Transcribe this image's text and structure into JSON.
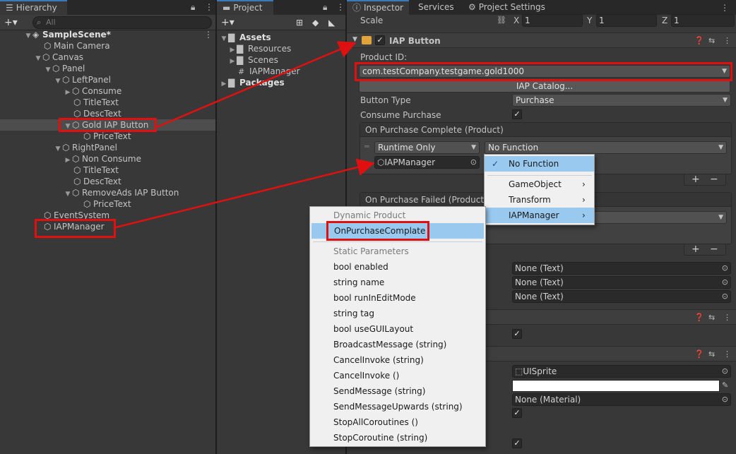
{
  "hierarchy": {
    "tab_label": "Hierarchy",
    "add_label": "+▾",
    "search_placeholder": "All",
    "items": [
      {
        "label": "SampleScene*"
      },
      {
        "label": "Main Camera"
      },
      {
        "label": "Canvas"
      },
      {
        "label": "Panel"
      },
      {
        "label": "LeftPanel"
      },
      {
        "label": "Consume"
      },
      {
        "label": "TitleText"
      },
      {
        "label": "DescText"
      },
      {
        "label": "Gold IAP Button"
      },
      {
        "label": "PriceText"
      },
      {
        "label": "RightPanel"
      },
      {
        "label": "Non Consume"
      },
      {
        "label": "TitleText"
      },
      {
        "label": "DescText"
      },
      {
        "label": "RemoveAds IAP Button"
      },
      {
        "label": "PriceText"
      },
      {
        "label": "EventSystem"
      },
      {
        "label": "IAPManager"
      }
    ]
  },
  "project": {
    "tab_label": "Project",
    "add_label": "+▾",
    "items": [
      {
        "label": "Assets"
      },
      {
        "label": "Resources"
      },
      {
        "label": "Scenes"
      },
      {
        "label": "IAPManager"
      },
      {
        "label": "Packages"
      }
    ]
  },
  "inspector": {
    "tabs": [
      "Inspector",
      "Services",
      "Project Settings"
    ],
    "scale": {
      "label": "Scale",
      "x_label": "X",
      "x": "1",
      "y_label": "Y",
      "y": "1",
      "z_label": "Z",
      "z": "1"
    },
    "component_title": "IAP Button",
    "product_id_label": "Product ID:",
    "product_id_value": "com.testCompany.testgame.gold1000",
    "iap_catalog_button": "IAP Catalog...",
    "button_type_label": "Button Type",
    "button_type_value": "Purchase",
    "consume_purchase_label": "Consume Purchase",
    "on_purchase_complete_title": "On Purchase Complete (Product)",
    "runtime_only": "Runtime Only",
    "no_function": "No Function",
    "object_field": "IAPManager",
    "on_purchase_failed_title": "On Purchase Failed (Product, P",
    "none_text_1": "None (Text)",
    "none_text_2": "None (Text)",
    "none_text_3": "None (Text)",
    "uisprite": "UISprite",
    "none_material": "None (Material)"
  },
  "function_menu": {
    "items": [
      "No Function",
      "GameObject",
      "Transform",
      "IAPManager"
    ]
  },
  "method_menu": {
    "dynamic_header": "Dynamic Product",
    "dynamic_items": [
      "OnPurchaseComplate"
    ],
    "static_header": "Static Parameters",
    "static_items": [
      "bool enabled",
      "string name",
      "bool runInEditMode",
      "string tag",
      "bool useGUILayout",
      "BroadcastMessage (string)",
      "CancelInvoke (string)",
      "CancelInvoke ()",
      "SendMessage (string)",
      "SendMessageUpwards (string)",
      "StopAllCoroutines ()",
      "StopCoroutine (string)"
    ]
  },
  "colors": {
    "highlight": "#e01010",
    "selection": "#99c9ef",
    "accent": "#3a79bb"
  }
}
